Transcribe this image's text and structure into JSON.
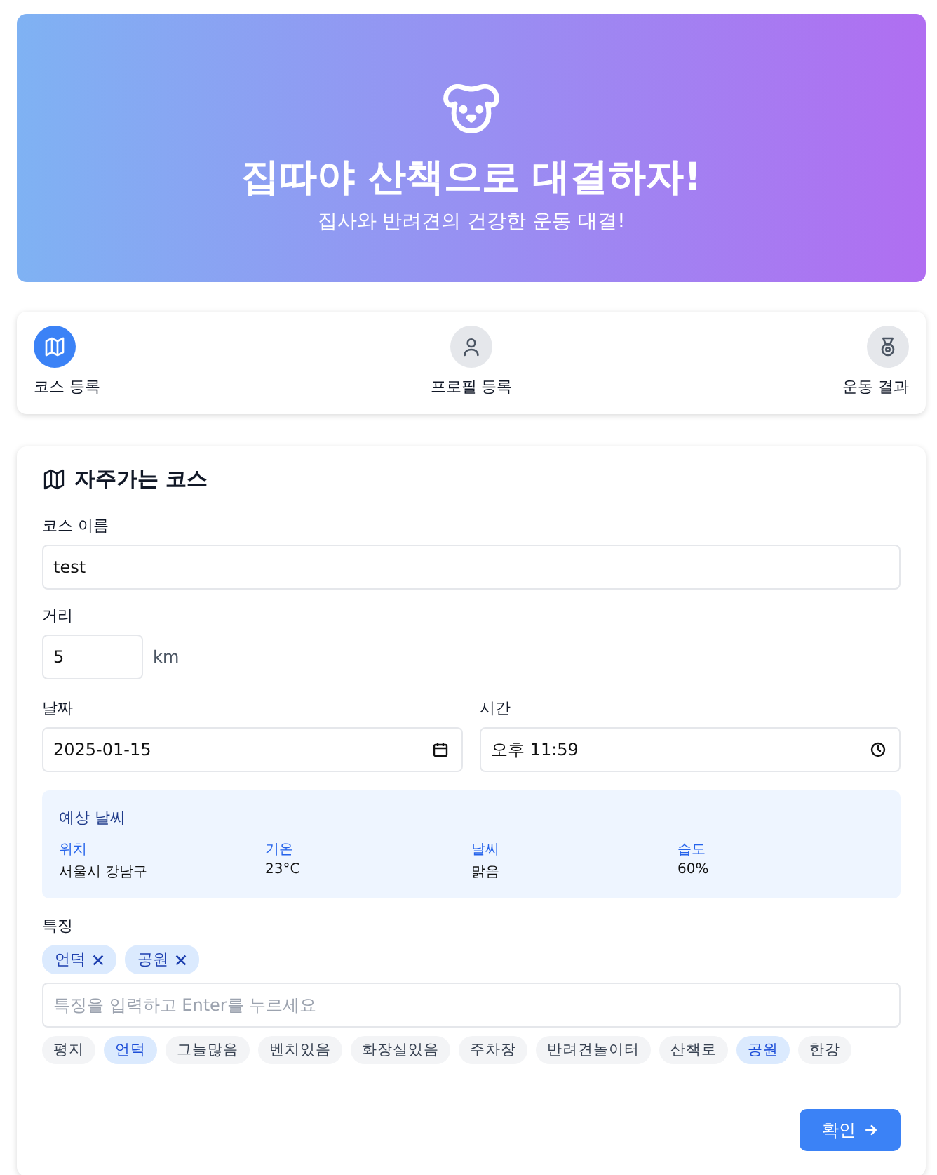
{
  "header": {
    "title": "집따야 산책으로 대결하자!",
    "subtitle": "집사와 반려견의 건강한 운동 대결!"
  },
  "steps": [
    {
      "label": "코스 등록",
      "kind": "map",
      "selected": true
    },
    {
      "label": "프로필 등록",
      "kind": "person",
      "selected": false
    },
    {
      "label": "운동 결과",
      "kind": "medal",
      "selected": false
    }
  ],
  "form": {
    "title": "자주가는 코스",
    "course_name": {
      "label": "코스 이름",
      "value": "test"
    },
    "distance": {
      "label": "거리",
      "value": "5",
      "unit": "km"
    },
    "date": {
      "label": "날짜",
      "value": "2025-01-15"
    },
    "time": {
      "label": "시간",
      "value": "오후 11:59"
    },
    "weather": {
      "title": "예상 날씨",
      "items": [
        {
          "label": "위치",
          "value": "서울시 강남구"
        },
        {
          "label": "기온",
          "value": "23°C"
        },
        {
          "label": "날씨",
          "value": "맑음"
        },
        {
          "label": "습도",
          "value": "60%"
        }
      ]
    },
    "features": {
      "label": "특징",
      "tags": [
        "언덕",
        "공원"
      ],
      "placeholder": "특징을 입력하고 Enter를 누르세요",
      "suggestions": [
        {
          "label": "평지",
          "selected": false
        },
        {
          "label": "언덕",
          "selected": true
        },
        {
          "label": "그늘많음",
          "selected": false
        },
        {
          "label": "벤치있음",
          "selected": false
        },
        {
          "label": "화장실있음",
          "selected": false
        },
        {
          "label": "주차장",
          "selected": false
        },
        {
          "label": "반려견놀이터",
          "selected": false
        },
        {
          "label": "산책로",
          "selected": false
        },
        {
          "label": "공원",
          "selected": true
        },
        {
          "label": "한강",
          "selected": false
        }
      ]
    },
    "submit": "확인"
  }
}
